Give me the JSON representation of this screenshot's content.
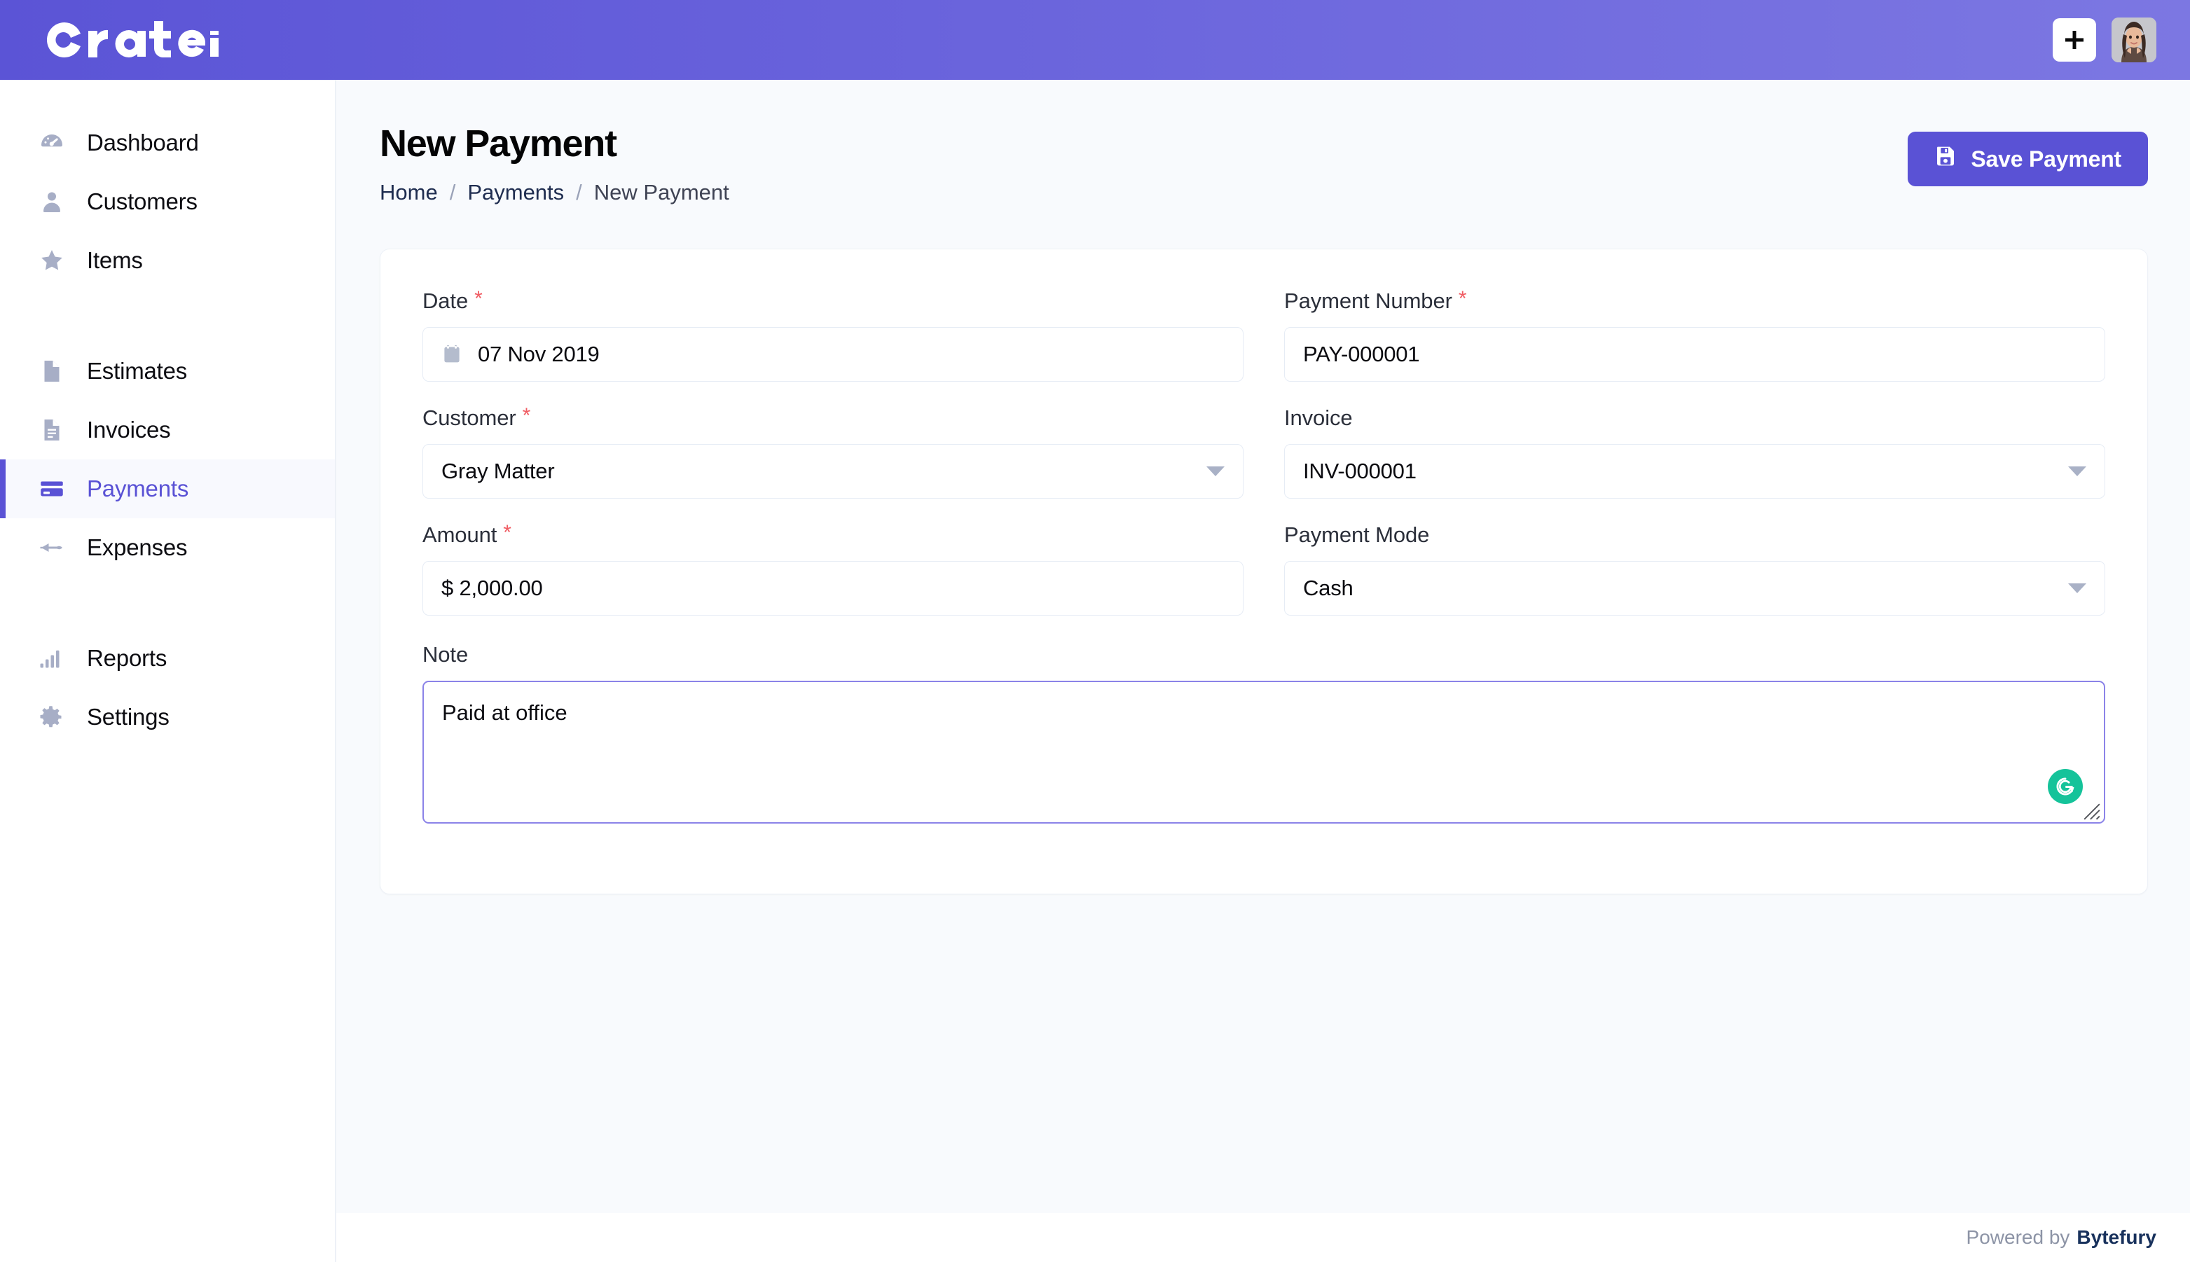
{
  "header": {
    "logo_text": "crater",
    "add_button_label": "+",
    "add_icon": "plus-icon",
    "avatar_alt": "user-avatar"
  },
  "sidebar": {
    "groups": [
      {
        "items": [
          {
            "label": "Dashboard",
            "icon": "speedometer-icon",
            "active": false
          },
          {
            "label": "Customers",
            "icon": "user-icon",
            "active": false
          },
          {
            "label": "Items",
            "icon": "star-icon",
            "active": false
          }
        ]
      },
      {
        "items": [
          {
            "label": "Estimates",
            "icon": "document-icon",
            "active": false
          },
          {
            "label": "Invoices",
            "icon": "document-lines-icon",
            "active": false
          },
          {
            "label": "Payments",
            "icon": "credit-card-icon",
            "active": true
          },
          {
            "label": "Expenses",
            "icon": "rocket-icon",
            "active": false
          }
        ]
      },
      {
        "items": [
          {
            "label": "Reports",
            "icon": "bar-chart-icon",
            "active": false
          },
          {
            "label": "Settings",
            "icon": "gear-icon",
            "active": false
          }
        ]
      }
    ]
  },
  "page": {
    "title": "New Payment",
    "breadcrumb": {
      "home": "Home",
      "payments": "Payments",
      "current": "New Payment",
      "separator": "/"
    },
    "save_button": {
      "label": "Save Payment",
      "icon": "save-disk-icon"
    }
  },
  "form": {
    "date": {
      "label": "Date",
      "required": "*",
      "value": "07 Nov 2019",
      "icon": "calendar-icon"
    },
    "payment_number": {
      "label": "Payment Number",
      "required": "*",
      "value": "PAY-000001"
    },
    "customer": {
      "label": "Customer",
      "required": "*",
      "value": "Gray Matter"
    },
    "invoice": {
      "label": "Invoice",
      "value": "INV-000001"
    },
    "amount": {
      "label": "Amount",
      "required": "*",
      "value": "$ 2,000.00"
    },
    "payment_mode": {
      "label": "Payment Mode",
      "value": "Cash"
    },
    "note": {
      "label": "Note",
      "value": "Paid at office",
      "assistant_icon": "grammarly-icon"
    }
  },
  "footer": {
    "powered_by": "Powered by",
    "brand": "Bytefury"
  },
  "colors": {
    "brand_purple": "#5a52d5",
    "header_gradient_start": "#5b54d6",
    "header_gradient_end": "#7c77e2",
    "required_red": "#f05c63",
    "page_bg": "#f8fafd",
    "icon_gray": "#a7aec6",
    "focus_border": "#8b83e8",
    "grammarly_green": "#15c39a"
  }
}
